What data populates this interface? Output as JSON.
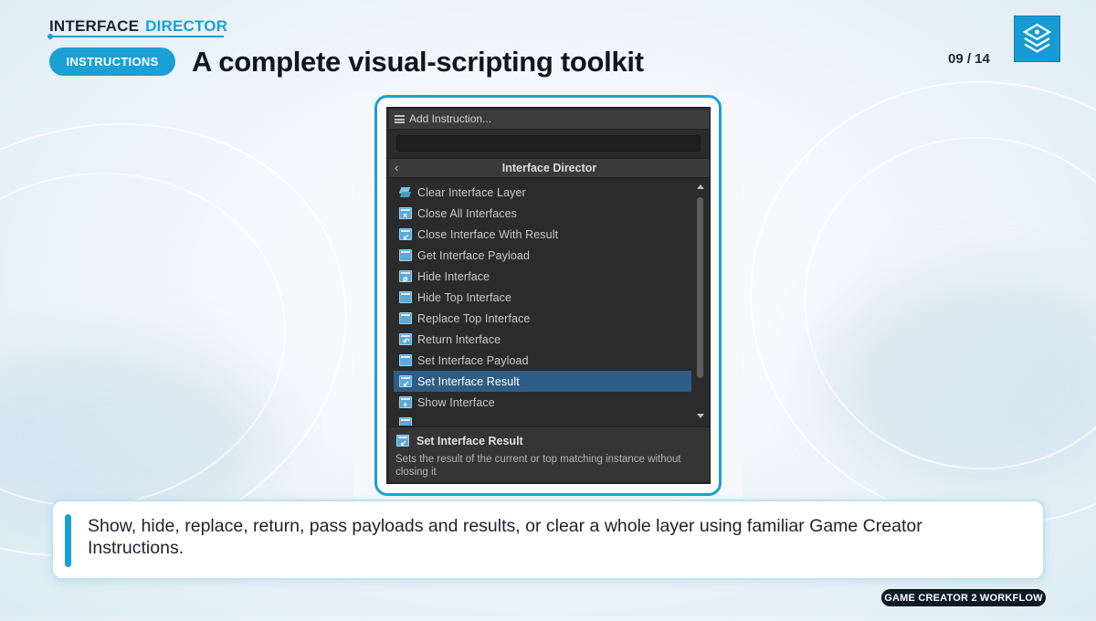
{
  "header": {
    "brand_word1": "INTERFACE",
    "brand_word2": "DIRECTOR",
    "section_pill": "INSTRUCTIONS",
    "title": "A complete visual-scripting toolkit",
    "page_indicator": "09 / 14"
  },
  "window": {
    "title": "Add Instruction...",
    "search_value": "",
    "nav_label": "Interface Director",
    "items": [
      {
        "label": "Clear Interface Layer",
        "icon": "layers-icon"
      },
      {
        "label": "Close All Interfaces",
        "icon": "window-close-all-icon"
      },
      {
        "label": "Close Interface With Result",
        "icon": "window-result-icon"
      },
      {
        "label": "Get Interface Payload",
        "icon": "window-icon"
      },
      {
        "label": "Hide Interface",
        "icon": "window-hide-icon"
      },
      {
        "label": "Hide Top Interface",
        "icon": "window-stack-hide-icon"
      },
      {
        "label": "Replace Top Interface",
        "icon": "window-replace-icon"
      },
      {
        "label": "Return Interface",
        "icon": "window-return-icon"
      },
      {
        "label": "Set Interface Payload",
        "icon": "window-icon"
      },
      {
        "label": "Set Interface Result",
        "icon": "window-result-icon",
        "selected": true
      },
      {
        "label": "Show Interface",
        "icon": "window-show-icon"
      }
    ],
    "description": {
      "name": "Set Interface Result",
      "text": "Sets the result of the current or top matching instance without closing it"
    }
  },
  "caption": {
    "text": "Show, hide, replace, return, pass payloads and results, or clear a whole layer using familiar Game Creator Instructions."
  },
  "footer": {
    "label": "GAME CREATOR 2 WORKFLOW"
  },
  "colors": {
    "accent": "#1aa0d4",
    "title_text": "#0e1622",
    "editor_bg": "#2b2b2b",
    "selection": "#2c5d87",
    "footer_bg": "#0f1a26"
  }
}
